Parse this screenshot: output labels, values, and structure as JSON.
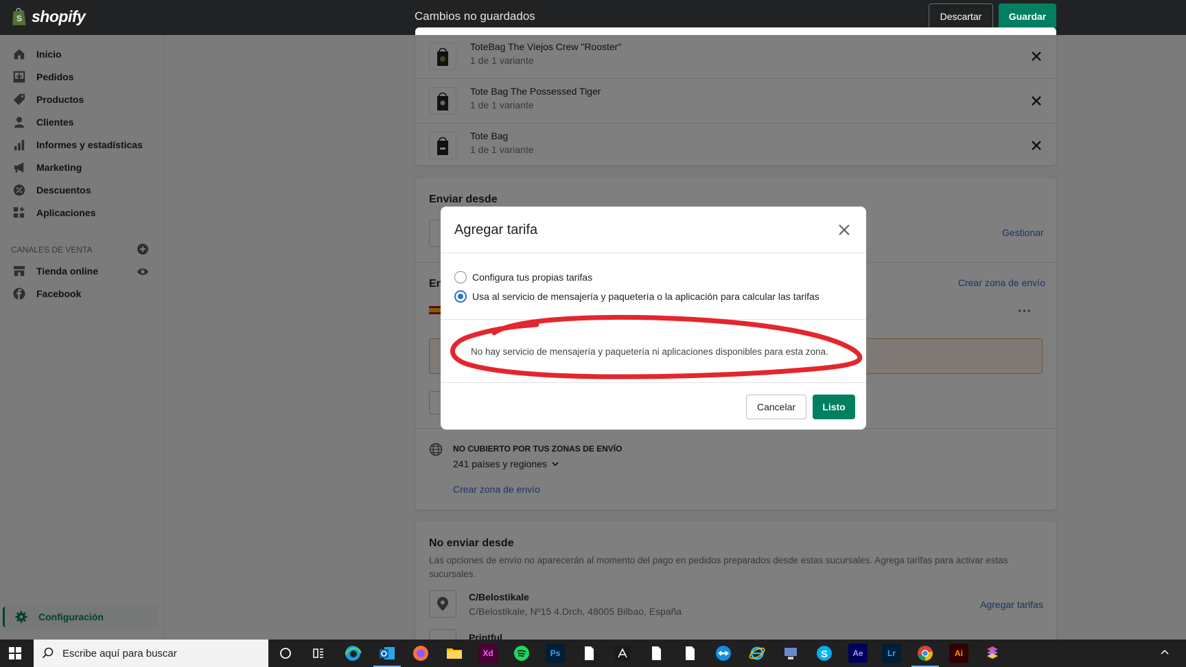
{
  "topbar": {
    "logo_text": "shopify",
    "unsaved_label": "Cambios no guardados",
    "discard_label": "Descartar",
    "save_label": "Guardar"
  },
  "sidebar": {
    "items": [
      {
        "label": "Inicio",
        "icon": "home-icon"
      },
      {
        "label": "Pedidos",
        "icon": "orders-icon"
      },
      {
        "label": "Productos",
        "icon": "tag-icon"
      },
      {
        "label": "Clientes",
        "icon": "person-icon"
      },
      {
        "label": "Informes y estadísticas",
        "icon": "bar-chart-icon"
      },
      {
        "label": "Marketing",
        "icon": "megaphone-icon"
      },
      {
        "label": "Descuentos",
        "icon": "discount-icon"
      },
      {
        "label": "Aplicaciones",
        "icon": "apps-icon"
      }
    ],
    "channels_label": "CANALES DE VENTA",
    "channels": [
      {
        "label": "Tienda online",
        "icon": "store-icon"
      },
      {
        "label": "Facebook",
        "icon": "facebook-icon"
      }
    ],
    "settings_label": "Configuración"
  },
  "products": [
    {
      "name": "ToteBag The Viejos Crew \"Rooster\"",
      "variants": "1 de 1 variante"
    },
    {
      "name": "Tote Bag The Possessed Tiger",
      "variants": "1 de 1 variante"
    },
    {
      "name": "Tote Bag",
      "variants": "1 de 1 variante"
    }
  ],
  "ship_from": {
    "heading": "Enviar desde",
    "manage_link": "Gestionar",
    "zone_heading_partial": "En",
    "create_zone_link": "Crear zona de envío"
  },
  "not_covered": {
    "label": "NO CUBIERTO POR TUS ZONAS DE ENVÍO",
    "countries": "241 países y regiones",
    "create_zone_link": "Crear zona de envío"
  },
  "no_ship_from": {
    "heading": "No enviar desde",
    "description": "Las opciones de envío no aparecerán al momento del pago en pedidos preparados desde estas sucursales. Agrega tarifas para activar estas sucursales.",
    "location_name": "C/Belostikale",
    "location_address": "C/Belostikale, Nº15 4.Drch, 48005 Bilbao, España",
    "add_rates_link": "Agregar tarifas",
    "next_location": "Printful"
  },
  "modal": {
    "title": "Agregar tarifa",
    "option_own": "Configura tus propias tarifas",
    "option_carrier": "Usa al servicio de mensajería y paquetería o la aplicación para calcular las tarifas",
    "selected_option": "option_carrier",
    "no_service_message": "No hay servicio de mensajería y paquetería ni aplicaciones disponibles para esta zona.",
    "cancel_label": "Cancelar",
    "done_label": "Listo",
    "annotation_color": "#e3262d"
  },
  "taskbar": {
    "search_placeholder": "Escribe aquí para buscar",
    "apps": [
      {
        "name": "Xd",
        "color": "#470137",
        "text_color": "#ff61f6"
      },
      {
        "name": "Ps",
        "color": "#001e36",
        "text_color": "#31a8ff"
      },
      {
        "name": "Ae",
        "color": "#00005b",
        "text_color": "#9999ff"
      },
      {
        "name": "Lr",
        "color": "#001e36",
        "text_color": "#31a8ff"
      },
      {
        "name": "Ai",
        "color": "#330000",
        "text_color": "#ff9a00"
      }
    ]
  },
  "colors": {
    "primary_green": "#008060",
    "link_blue": "#2c6ecb",
    "topbar_bg": "#202223",
    "warning_bg": "#fff5ea"
  }
}
